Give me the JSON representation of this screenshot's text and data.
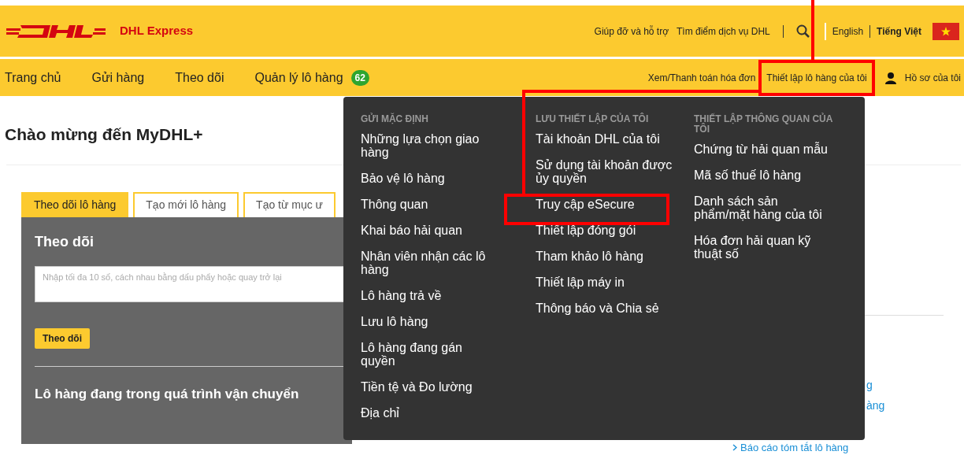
{
  "header": {
    "brand": "DHL Express",
    "utility_links": [
      "Giúp đỡ và hỗ trợ",
      "Tìm điểm dịch vụ DHL"
    ],
    "languages": [
      {
        "label": "English",
        "selected": false
      },
      {
        "label": "Tiếng Việt",
        "selected": true
      }
    ]
  },
  "nav": {
    "items": [
      {
        "label": "Trang chủ"
      },
      {
        "label": "Gửi hàng"
      },
      {
        "label": "Theo dõi"
      },
      {
        "label": "Quản lý lô hàng",
        "badge": "62"
      }
    ],
    "right_links": [
      {
        "label": "Xem/Thanh toán hóa đơn",
        "active": false
      },
      {
        "label": "Thiết lập lô hàng của tôi",
        "active": true
      },
      {
        "label": "Hồ sơ của tôi",
        "active": false
      }
    ]
  },
  "page_title": "Chào mừng đến MyDHL+",
  "tabs": [
    {
      "label": "Theo dõi lô hàng",
      "selected": true
    },
    {
      "label": "Tạo mới lô hàng",
      "selected": false
    },
    {
      "label": "Tạo từ mục ư",
      "selected": false
    }
  ],
  "track_panel": {
    "title": "Theo dõi",
    "placeholder": "Nhập tối đa 10 số, cách nhau bằng dấu phẩy hoặc quay trở lại",
    "button": "Theo dõi",
    "section": "Lô hàng đang trong quá trình vận chuyển"
  },
  "side_links": [
    "g",
    "àng",
    "Báo cáo tóm tắt lô hàng"
  ],
  "menu": {
    "columns": [
      {
        "heading": "GỬI MẶC ĐỊNH",
        "items": [
          "Những lựa chọn giao hàng",
          "Bảo vệ lô hàng",
          "Thông quan",
          "Khai báo hải quan",
          "Nhân viên nhận các lô hàng",
          "Lô hàng trả về",
          "Lưu lô hàng",
          "Lô hàng đang gán quyền",
          "Tiền tệ và Đo lường",
          "Địa chỉ"
        ]
      },
      {
        "heading": "LƯU THIẾT LẬP CỦA TÔI",
        "items": [
          "Tài khoản DHL của tôi",
          "Sử dụng tài khoản được ủy quyền",
          "Truy cập eSecure",
          "Thiết lập đóng gói",
          "Tham khảo lô hàng",
          "Thiết lập máy in",
          "Thông báo và Chia sẻ"
        ]
      },
      {
        "heading": "THIẾT LẬP THÔNG QUAN CỦA TÔI",
        "items": [
          "Chứng từ hải quan mẫu",
          "Mã số thuế lô hàng",
          "Danh sách sản phẩm/mặt hàng của tôi",
          "Hóa đơn hải quan kỹ thuật số"
        ]
      }
    ]
  }
}
